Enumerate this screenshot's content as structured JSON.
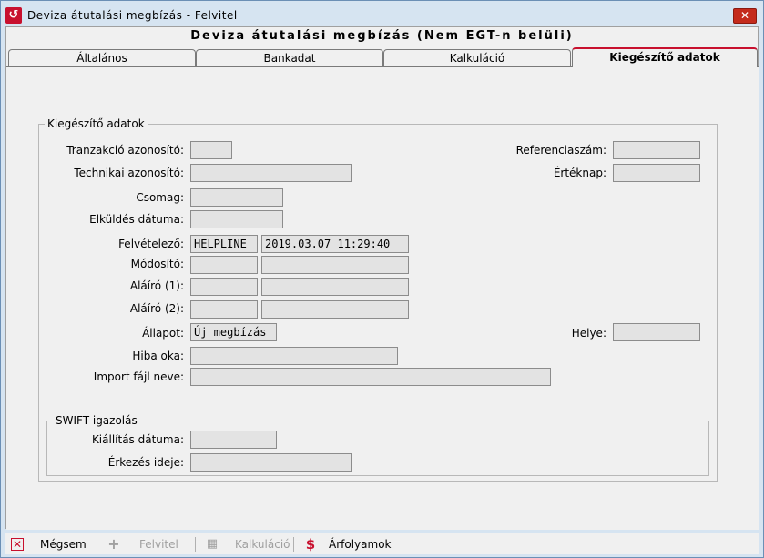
{
  "window": {
    "title": "Deviza átutalási megbízás - Felvitel",
    "heading": "Deviza átutalási megbízás (Nem EGT-n belüli)"
  },
  "tabs": [
    {
      "label": "Általános"
    },
    {
      "label": "Bankadat"
    },
    {
      "label": "Kalkuláció"
    },
    {
      "label": "Kiegészítő adatok"
    }
  ],
  "kiegeszito": {
    "legend": "Kiegészítő adatok",
    "tranzakcio_label": "Tranzakció azonosító:",
    "tranzakcio_value": "",
    "technikai_label": "Technikai azonosító:",
    "technikai_value": "",
    "csomag_label": "Csomag:",
    "csomag_value": "",
    "elkuldes_label": "Elküldés dátuma:",
    "elkuldes_value": "",
    "felvetelezo_label": "Felvételező:",
    "felvetelezo_user": "HELPLINE",
    "felvetelezo_date": "2019.03.07 11:29:40",
    "modosito_label": "Módosító:",
    "modosito_user": "",
    "modosito_date": "",
    "alairo1_label": "Aláíró (1):",
    "alairo1_user": "",
    "alairo1_date": "",
    "alairo2_label": "Aláíró (2):",
    "alairo2_user": "",
    "alairo2_date": "",
    "allapot_label": "Állapot:",
    "allapot_value": "Új megbízás",
    "hiba_label": "Hiba oka:",
    "hiba_value": "",
    "import_label": "Import fájl neve:",
    "import_value": "",
    "referencia_label": "Referenciaszám:",
    "referencia_value": "",
    "erteknap_label": "Értéknap:",
    "erteknap_value": "",
    "helye_label": "Helye:",
    "helye_value": ""
  },
  "swift": {
    "legend": "SWIFT igazolás",
    "kiallitas_label": "Kiállítás dátuma:",
    "kiallitas_value": "",
    "erkezes_label": "Érkezés ideje:",
    "erkezes_value": ""
  },
  "toolbar": {
    "cancel_label": "Mégsem",
    "add_label": "Felvitel",
    "calc_label": "Kalkuláció",
    "rates_label": "Árfolyamok"
  },
  "colors": {
    "accent": "#c8102e",
    "window_bg": "#d6e4f1",
    "client_bg": "#f0f0f0",
    "field_bg": "#e3e3e3"
  }
}
